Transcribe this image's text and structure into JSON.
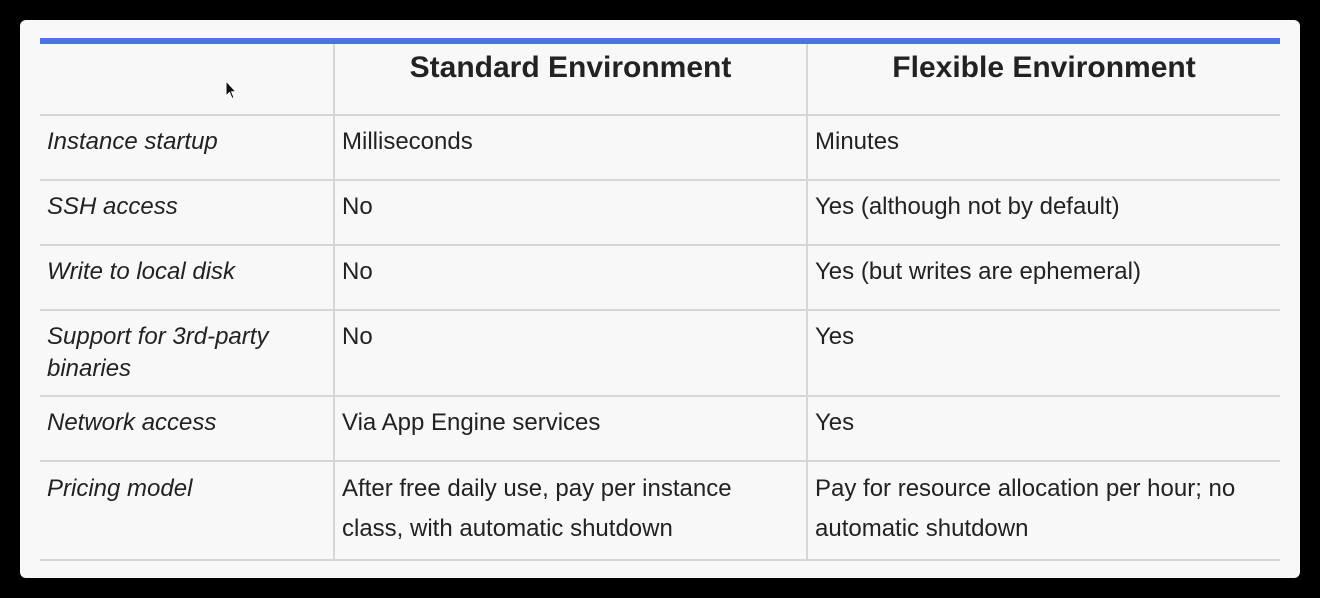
{
  "table": {
    "headers": [
      "",
      "Standard Environment",
      "Flexible Environment"
    ],
    "rows": [
      {
        "feature": "Instance startup",
        "standard": "Milliseconds",
        "flexible": "Minutes"
      },
      {
        "feature": "SSH access",
        "standard": "No",
        "flexible": "Yes (although not by default)"
      },
      {
        "feature": "Write to local disk",
        "standard": "No",
        "flexible": "Yes (but writes are ephemeral)"
      },
      {
        "feature": "Support for 3rd-party binaries",
        "standard": "No",
        "flexible": "Yes"
      },
      {
        "feature": "Network access",
        "standard": "Via App Engine services",
        "flexible": "Yes"
      },
      {
        "feature": "Pricing model",
        "standard": "After free daily use, pay per instance class, with automatic shutdown",
        "flexible": "Pay for resource allocation per hour; no automatic shutdown"
      }
    ]
  },
  "colors": {
    "accent": "#4a74de",
    "border": "#d6d6d6",
    "background": "#f8f8f8"
  },
  "icons": {
    "cursor": "mouse-pointer-icon"
  }
}
